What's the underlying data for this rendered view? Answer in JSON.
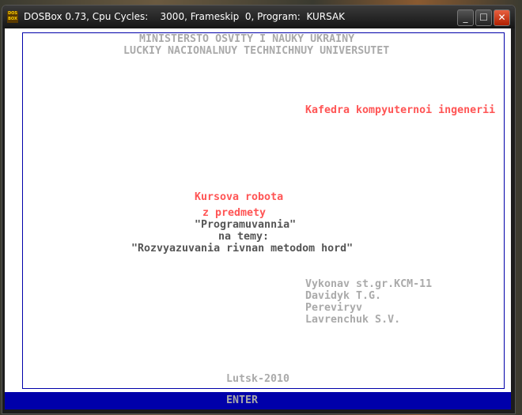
{
  "window": {
    "title": "DOSBox 0.73, Cpu Cycles:    3000, Frameskip  0, Program:  KURSAK",
    "icon_text": "DOS BOX"
  },
  "screen": {
    "ministry": "MINISTERSTO OSVITY I NAUKY UKRAINY",
    "university": "LUCKIY NACIONALNUY TECHNICHNUY UNIVERSUTET",
    "department": "Kafedra kompyuternoi ingenerii",
    "work": "Kursova robota",
    "subject_prefix": "z predmety",
    "subject": "\"Programuvannia\"",
    "topic_prefix": "na temy:",
    "topic": "\"Rozvyazuvania rivnan metodom hord\"",
    "author_label": "Vykonav st.gr.KCM-11",
    "author": "Davidyk T.G.",
    "checker_label": "Pereviryv",
    "checker": "Lavrenchuk S.V.",
    "city_year": "Lutsk-2010",
    "enter": "ENTER"
  }
}
